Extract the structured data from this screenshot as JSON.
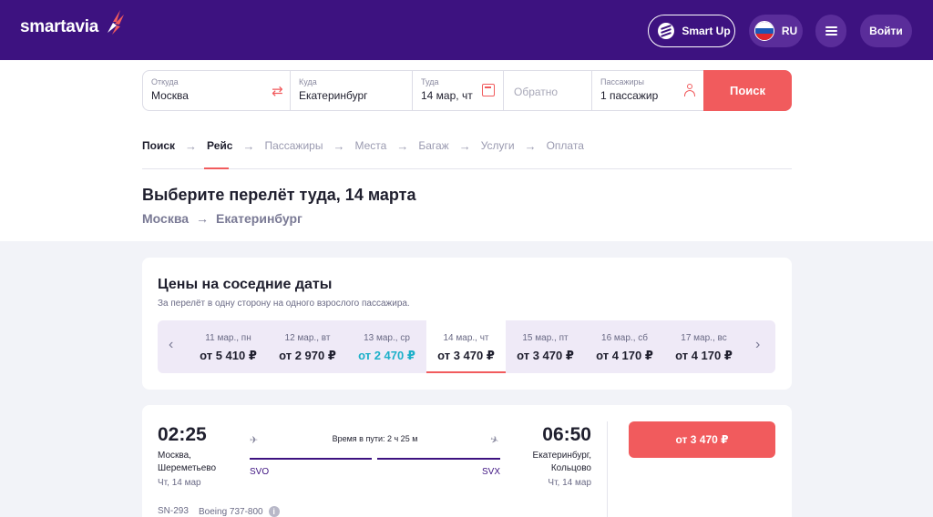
{
  "header": {
    "logo_text": "smartavia",
    "smartup_label": "Smart Up",
    "lang_label": "RU",
    "login_label": "Войти",
    "colors": {
      "background": "#3d1280",
      "accent": "#f15b5d"
    }
  },
  "search": {
    "from": {
      "label": "Откуда",
      "value": "Москва"
    },
    "to": {
      "label": "Куда",
      "value": "Екатеринбург"
    },
    "depart": {
      "label": "Туда",
      "value": "14 мар, чт"
    },
    "return": {
      "placeholder": "Обратно"
    },
    "passengers": {
      "label": "Пассажиры",
      "value": "1 пассажир"
    },
    "button_label": "Поиск"
  },
  "steps": [
    {
      "label": "Поиск",
      "state": "done"
    },
    {
      "label": "Рейс",
      "state": "active"
    },
    {
      "label": "Пассажиры",
      "state": "pending"
    },
    {
      "label": "Места",
      "state": "pending"
    },
    {
      "label": "Багаж",
      "state": "pending"
    },
    {
      "label": "Услуги",
      "state": "pending"
    },
    {
      "label": "Оплата",
      "state": "pending"
    }
  ],
  "page": {
    "title": "Выберите перелёт туда, 14 марта",
    "route_from": "Москва",
    "route_to": "Екатеринбург"
  },
  "nearby_dates": {
    "title": "Цены на соседние даты",
    "subtitle": "За перелёт в одну сторону на одного взрослого пассажира.",
    "dates": [
      {
        "date": "11 мар., пн",
        "price": "от 5 410 ₽"
      },
      {
        "date": "12 мар., вт",
        "price": "от 2 970 ₽"
      },
      {
        "date": "13 мар., ср",
        "price": "от 2 470 ₽",
        "cheapest": true
      },
      {
        "date": "14 мар., чт",
        "price": "от 3 470 ₽",
        "selected": true
      },
      {
        "date": "15 мар., пт",
        "price": "от 3 470 ₽"
      },
      {
        "date": "16 мар., сб",
        "price": "от 4 170 ₽"
      },
      {
        "date": "17 мар., вс",
        "price": "от 4 170 ₽"
      }
    ]
  },
  "flight": {
    "dep_time": "02:25",
    "dep_city": "Москва,",
    "dep_airport": "Шереметьево",
    "dep_date": "Чт, 14 мар",
    "dep_iata": "SVO",
    "arr_time": "06:50",
    "arr_city": "Екатеринбург,",
    "arr_airport": "Кольцово",
    "arr_date": "Чт, 14 мар",
    "arr_iata": "SVX",
    "duration": "Время в пути: 2 ч 25 м",
    "price_label": "от 3 470 ₽",
    "flight_number": "SN-293",
    "aircraft": "Boeing 737-800"
  }
}
